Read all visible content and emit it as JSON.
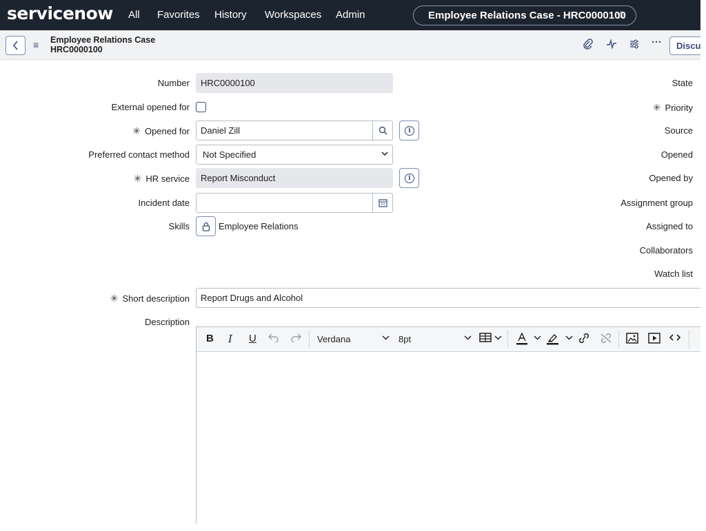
{
  "nav": {
    "logo": "servicenow",
    "items": [
      "All",
      "Favorites",
      "History",
      "Workspaces",
      "Admin"
    ],
    "record_pill": "Employee Relations Case - HRC0000100"
  },
  "header": {
    "title_line1": "Employee Relations Case",
    "title_line2": "HRC0000100",
    "discuss_label": "Discuss"
  },
  "form": {
    "left_labels": {
      "number": "Number",
      "external_opened_for": "External opened for",
      "opened_for": "Opened for",
      "preferred_contact_method": "Preferred contact method",
      "hr_service": "HR service",
      "incident_date": "Incident date",
      "skills": "Skills",
      "short_description": "Short description",
      "description": "Description"
    },
    "values": {
      "number": "HRC0000100",
      "external_opened_for_checked": false,
      "opened_for": "Daniel Zill",
      "preferred_contact_method": "Not Specified",
      "hr_service": "Report Misconduct",
      "incident_date": "",
      "skills": "Employee Relations",
      "short_description": "Report Drugs and Alcohol"
    },
    "right_labels": {
      "state": "State",
      "priority": "Priority",
      "source": "Source",
      "opened": "Opened",
      "opened_by": "Opened by",
      "assignment_group": "Assignment group",
      "assigned_to": "Assigned to",
      "collaborators": "Collaborators",
      "watch_list": "Watch list"
    }
  },
  "editor": {
    "font_family": "Verdana",
    "font_size": "8pt"
  },
  "colors": {
    "nav_bg": "#1c2430",
    "accent": "#3a4b77",
    "logo_accent": "#81b5a1"
  }
}
